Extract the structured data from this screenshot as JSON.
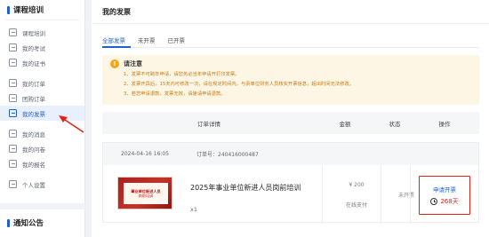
{
  "sidebar": {
    "section_title": "课程培训",
    "items": [
      {
        "label": "课程培训",
        "icon": "book-icon"
      },
      {
        "label": "我的考试",
        "icon": "exam-icon"
      },
      {
        "label": "我的证书",
        "icon": "certificate-icon"
      },
      {
        "label": "我的订单",
        "icon": "order-icon"
      },
      {
        "label": "团购订单",
        "icon": "group-order-icon"
      },
      {
        "label": "我的发票",
        "icon": "invoice-icon"
      },
      {
        "label": "我的消息",
        "icon": "message-icon"
      },
      {
        "label": "我的问卷",
        "icon": "survey-icon"
      },
      {
        "label": "我的报名",
        "icon": "signup-icon"
      },
      {
        "label": "个人设置",
        "icon": "settings-icon"
      }
    ],
    "notice_title": "通知公告"
  },
  "main": {
    "title": "我的发票",
    "tabs": [
      "全部发票",
      "未开票",
      "已开票"
    ],
    "notice": {
      "title": "请注意",
      "lines": [
        "1、发票不可跨年申请，请您务必当年申请开打印发票。",
        "2、发票开具后，15天内可修改一次，请在规定时间内，与责单位财务人员核实开票信息，超出时间无法修改。",
        "3、若您申请退款，发票无效，请速请申请退款。"
      ]
    },
    "table_headers": [
      "订单详情",
      "金额",
      "状态",
      "操作"
    ],
    "order": {
      "date": "2024-04-16 16:05",
      "order_no": "订单号：240416000487",
      "thumb_line1": "事业单位新进人员",
      "thumb_line2": "岗前培训",
      "course_name": "2025年事业单位新进人员岗前培训",
      "qty": "x1",
      "amount": "¥ 200",
      "pay_method": "在线支付",
      "status": "未开票",
      "action_label": "申请开票",
      "remaining": "268天"
    }
  },
  "colors": {
    "accent": "#1f5fd0",
    "highlight_red": "#e2231a",
    "notice_bg": "#fdf6e4",
    "notice_text": "#c47a12"
  }
}
